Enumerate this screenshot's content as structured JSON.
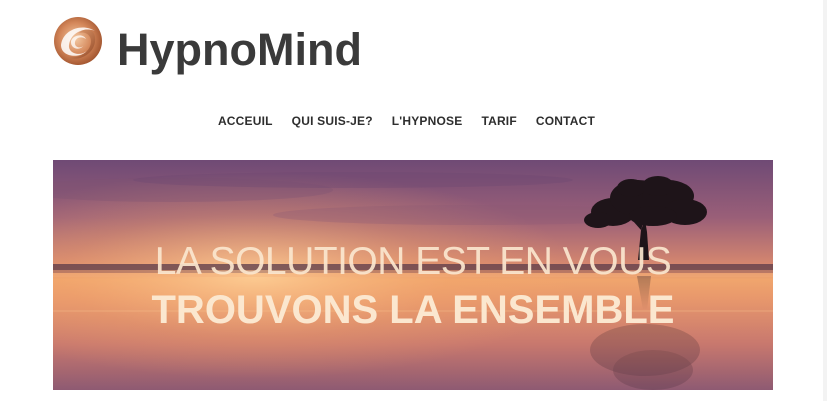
{
  "brand": {
    "name": "HypnoMind",
    "logo_icon": "swirl-logo-icon"
  },
  "nav": {
    "items": [
      {
        "label": "ACCEUIL"
      },
      {
        "label": "QUI SUIS-JE?"
      },
      {
        "label": "L'HYPNOSE"
      },
      {
        "label": "TARIF"
      },
      {
        "label": "CONTACT"
      }
    ]
  },
  "hero": {
    "line1": "LA SOLUTION EST EN VOUS",
    "line2": "TROUVONS LA ENSEMBLE",
    "image": "sunset-lake-tree-image"
  },
  "colors": {
    "brand_text": "#3a3a3a",
    "logo_orange": "#c97a45",
    "hero_text": "#fbe7cf"
  }
}
